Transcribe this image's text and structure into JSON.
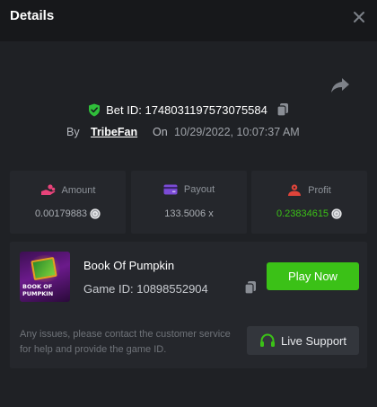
{
  "header": {
    "title": "Details"
  },
  "bet": {
    "id_text": "Bet ID: 1748031197573075584",
    "by_label": "By",
    "user": "TribeFan",
    "on_label": "On",
    "datetime": "10/29/2022, 10:07:37 AM"
  },
  "stats": {
    "amount": {
      "label": "Amount",
      "value": "0.00179883"
    },
    "payout": {
      "label": "Payout",
      "value": "133.5006 x"
    },
    "profit": {
      "label": "Profit",
      "value": "0.23834615"
    }
  },
  "game": {
    "name": "Book Of Pumpkin",
    "id_text": "Game ID: 10898552904",
    "thumb_line1": "BOOK OF",
    "thumb_line2": "PUMPKIN",
    "play_label": "Play Now"
  },
  "support": {
    "help_text": "Any issues, please contact the customer service for help and provide the game ID.",
    "button_label": "Live Support"
  },
  "icons": {
    "close": "close-icon",
    "share": "share-icon",
    "shield": "shield-check-icon",
    "copy": "copy-icon",
    "amount": "hand-coins-icon",
    "payout": "card-icon",
    "profit": "profit-icon",
    "coin": "coin-icon",
    "support": "headset-icon"
  },
  "colors": {
    "accent_green": "#3bc117",
    "profit_green": "#3bc117",
    "amount_pink": "#e8437a",
    "payout_purple": "#7b4bd6",
    "profit_red": "#e0443a",
    "shield_green": "#2fbe3a"
  }
}
